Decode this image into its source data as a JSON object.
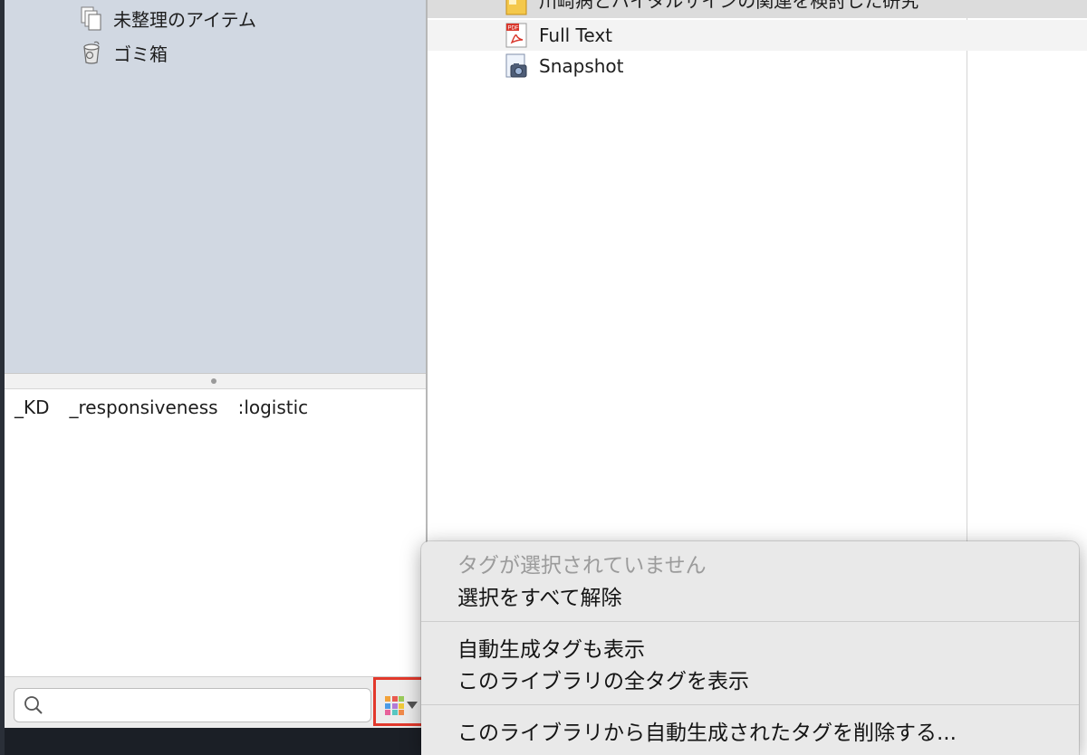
{
  "collections": {
    "items": [
      {
        "label": "未整理のアイテム",
        "icon": "unfiled-items-icon"
      },
      {
        "label": "ゴミ箱",
        "icon": "trash-icon"
      }
    ]
  },
  "tag_selector": {
    "tags": [
      "_KD",
      "_responsiveness",
      ":logistic"
    ],
    "search": {
      "placeholder": "",
      "value": ""
    },
    "actions_button": {
      "icon": "tag-colors-icon",
      "highlight_color": "#e2392c"
    }
  },
  "items": {
    "parent_title": "川崎病とバイタルサインの関連を検討した研究",
    "attachments": [
      {
        "label": "Full Text",
        "icon": "pdf-icon"
      },
      {
        "label": "Snapshot",
        "icon": "snapshot-icon"
      }
    ]
  },
  "context_menu": {
    "items": [
      {
        "label": "タグが選択されていません",
        "enabled": false
      },
      {
        "label": "選択をすべて解除",
        "enabled": true
      },
      {
        "label": "自動生成タグも表示",
        "enabled": true
      },
      {
        "label": "このライブラリの全タグを表示",
        "enabled": true
      },
      {
        "label": "このライブラリから自動生成されたタグを削除する...",
        "enabled": true
      }
    ]
  }
}
